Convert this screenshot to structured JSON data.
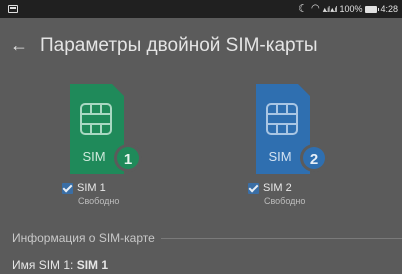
{
  "status_bar": {
    "battery_percent": "100%",
    "time": "4:28",
    "icons": [
      "notification-icon",
      "moon-icon",
      "wifi-icon",
      "signal-icon",
      "battery-icon"
    ]
  },
  "toolbar": {
    "title": "Параметры двойной SIM-карты"
  },
  "sims": [
    {
      "label": "SIM 1",
      "status": "Свободно",
      "number": "1",
      "card_text": "SIM",
      "color": "#1f8a5a",
      "checked": true
    },
    {
      "label": "SIM 2",
      "status": "Свободно",
      "number": "2",
      "card_text": "SIM",
      "color": "#2f6fb0",
      "checked": true
    }
  ],
  "section": {
    "title": "Информация о SIM-карте"
  },
  "sim_name_row": {
    "label": "Имя SIM 1:",
    "value": "SIM 1"
  }
}
